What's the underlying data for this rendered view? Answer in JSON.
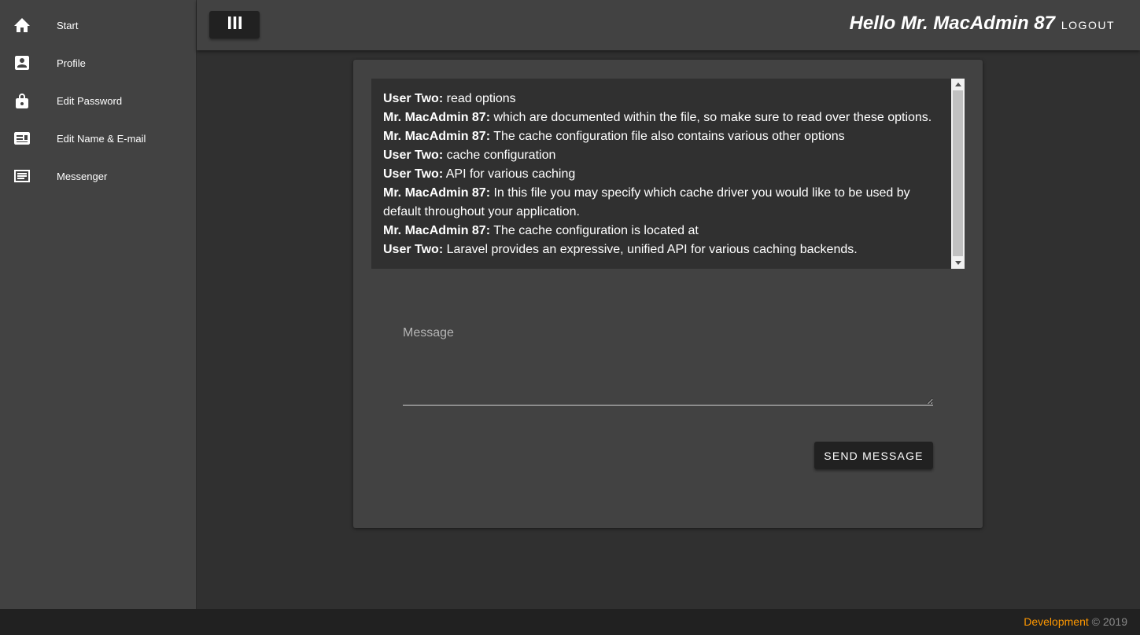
{
  "sidebar": {
    "items": [
      {
        "label": "Start",
        "icon": "home-icon"
      },
      {
        "label": "Profile",
        "icon": "account-box-icon"
      },
      {
        "label": "Edit Password",
        "icon": "lock-icon"
      },
      {
        "label": "Edit Name & E-mail",
        "icon": "id-card-icon"
      },
      {
        "label": "Messenger",
        "icon": "message-icon"
      }
    ]
  },
  "header": {
    "menu_icon": "view-column-icon",
    "greeting": "Hello Mr. MacAdmin 87",
    "logout_label": "LOGOUT"
  },
  "chat": {
    "messages": [
      {
        "sender": "User Two:",
        "text": "read options"
      },
      {
        "sender": "Mr. MacAdmin 87:",
        "text": "which are documented within the file, so make sure to read over these options."
      },
      {
        "sender": "Mr. MacAdmin 87:",
        "text": "The cache configuration file also contains various other options"
      },
      {
        "sender": "User Two:",
        "text": "cache configuration"
      },
      {
        "sender": "User Two:",
        "text": "API for various caching"
      },
      {
        "sender": "Mr. MacAdmin 87:",
        "text": "In this file you may specify which cache driver you would like to be used by default throughout your application."
      },
      {
        "sender": "Mr. MacAdmin 87:",
        "text": "The cache configuration is located at"
      },
      {
        "sender": "User Two:",
        "text": "Laravel provides an expressive, unified API for various caching backends."
      }
    ]
  },
  "form": {
    "message_placeholder": "Message",
    "message_value": "",
    "send_label": "SEND MESSAGE"
  },
  "footer": {
    "link_label": "Development",
    "copyright": "© 2019"
  },
  "colors": {
    "background": "#303030",
    "surface": "#424242",
    "button": "#212121",
    "accent": "#ff9800"
  }
}
